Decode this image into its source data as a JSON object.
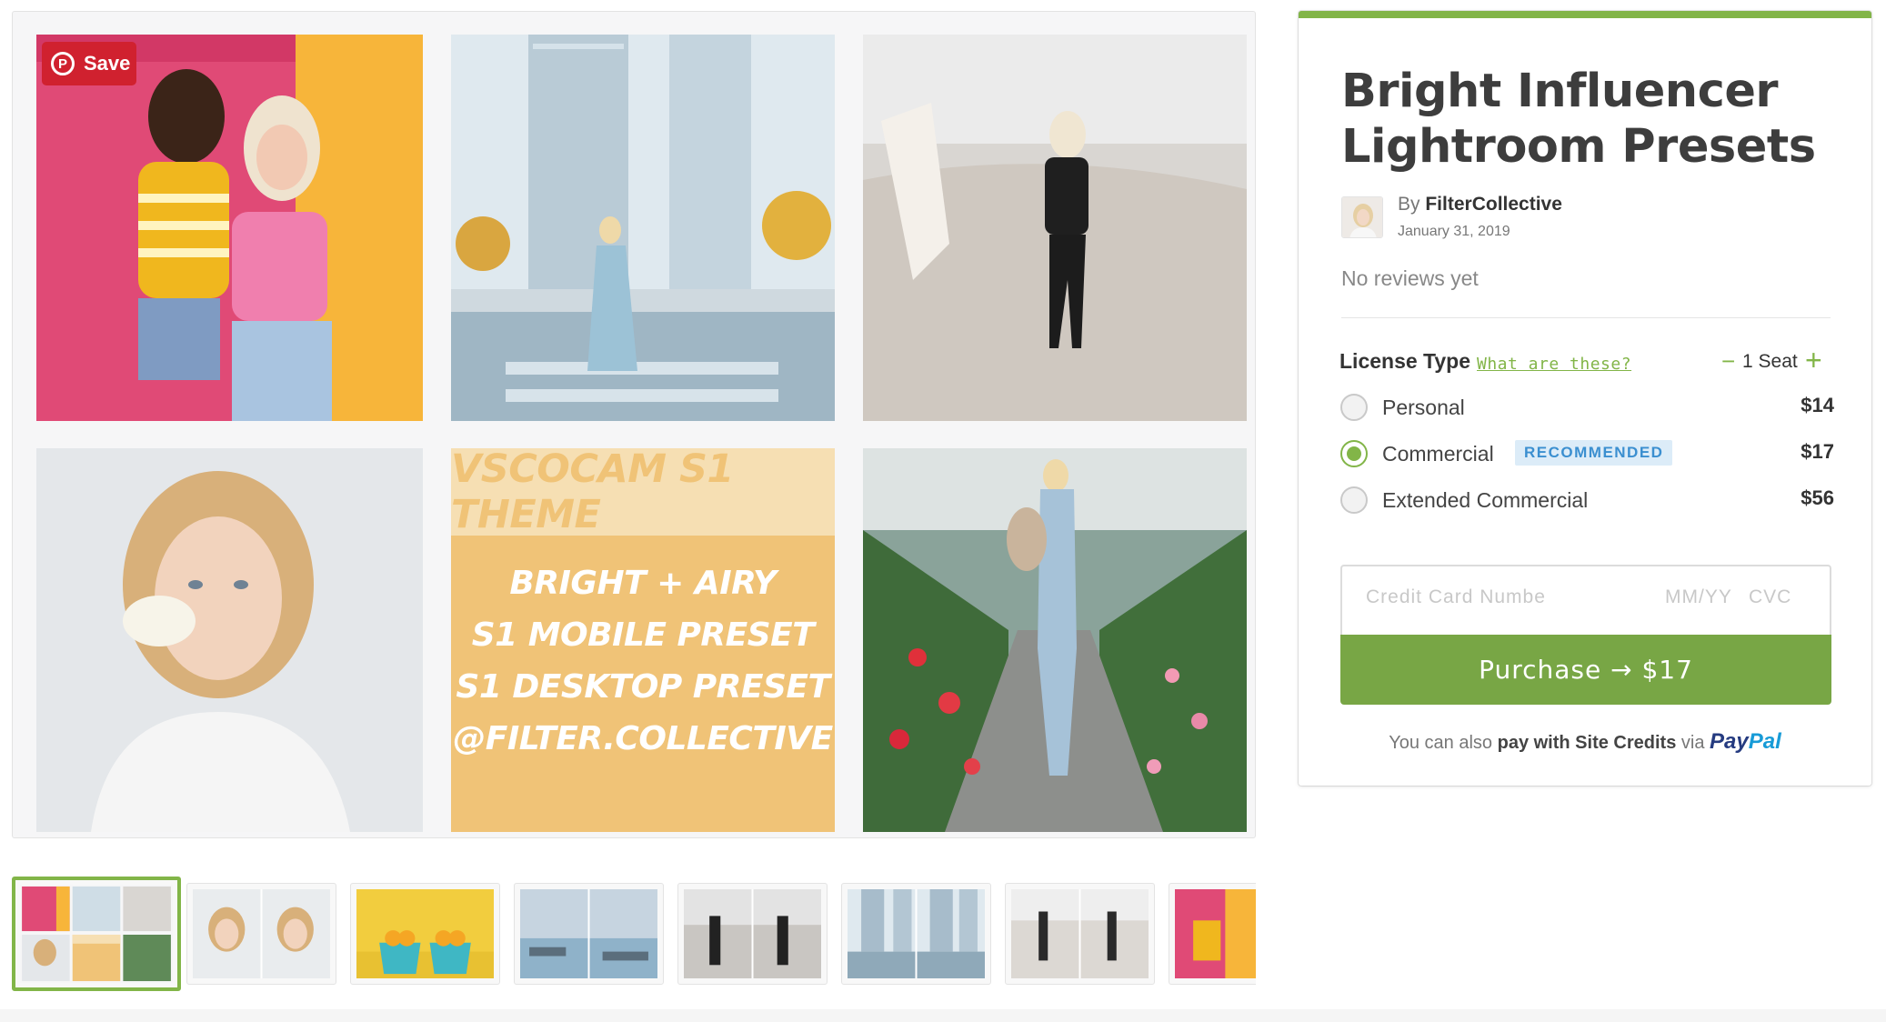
{
  "gallery": {
    "save_label": "Save",
    "promo": {
      "theme": "VSCOCAM S1 THEME",
      "lines": [
        "BRIGHT + AIRY",
        "S1 MOBILE PRESET",
        "S1 DESKTOP PRESET",
        "@FILTER.COLLECTIVE"
      ]
    }
  },
  "product": {
    "title": "Bright Influencer Lightroom Presets",
    "by": "By",
    "author": "FilterCollective",
    "date": "January 31, 2019",
    "reviews": "No reviews yet"
  },
  "license": {
    "label": "License Type",
    "help_link": "What are these?",
    "seat_minus": "−",
    "seats": "1 Seat",
    "seat_plus": "+",
    "options": [
      {
        "label": "Personal",
        "price": "$14",
        "checked": false
      },
      {
        "label": "Commercial",
        "price": "$17",
        "checked": true,
        "badge": "RECOMMENDED"
      },
      {
        "label": "Extended Commercial",
        "price": "$56",
        "checked": false
      }
    ]
  },
  "payment": {
    "card_placeholder": "Credit Card Numbe",
    "exp_placeholder": "MM/YY",
    "cvc_placeholder": "CVC",
    "purchase_label": "Purchase → $17",
    "alt_prefix": "You can also",
    "alt_credits": "pay with Site Credits",
    "alt_via": "via",
    "paypal_a": "Pay",
    "paypal_b": "Pal"
  },
  "colors": {
    "accent": "#82b548",
    "purchase": "#78a645",
    "save": "#d0212f",
    "promo_bg": "#f0c377",
    "badge_bg": "#dcecf8",
    "badge_text": "#3b8fd0"
  }
}
